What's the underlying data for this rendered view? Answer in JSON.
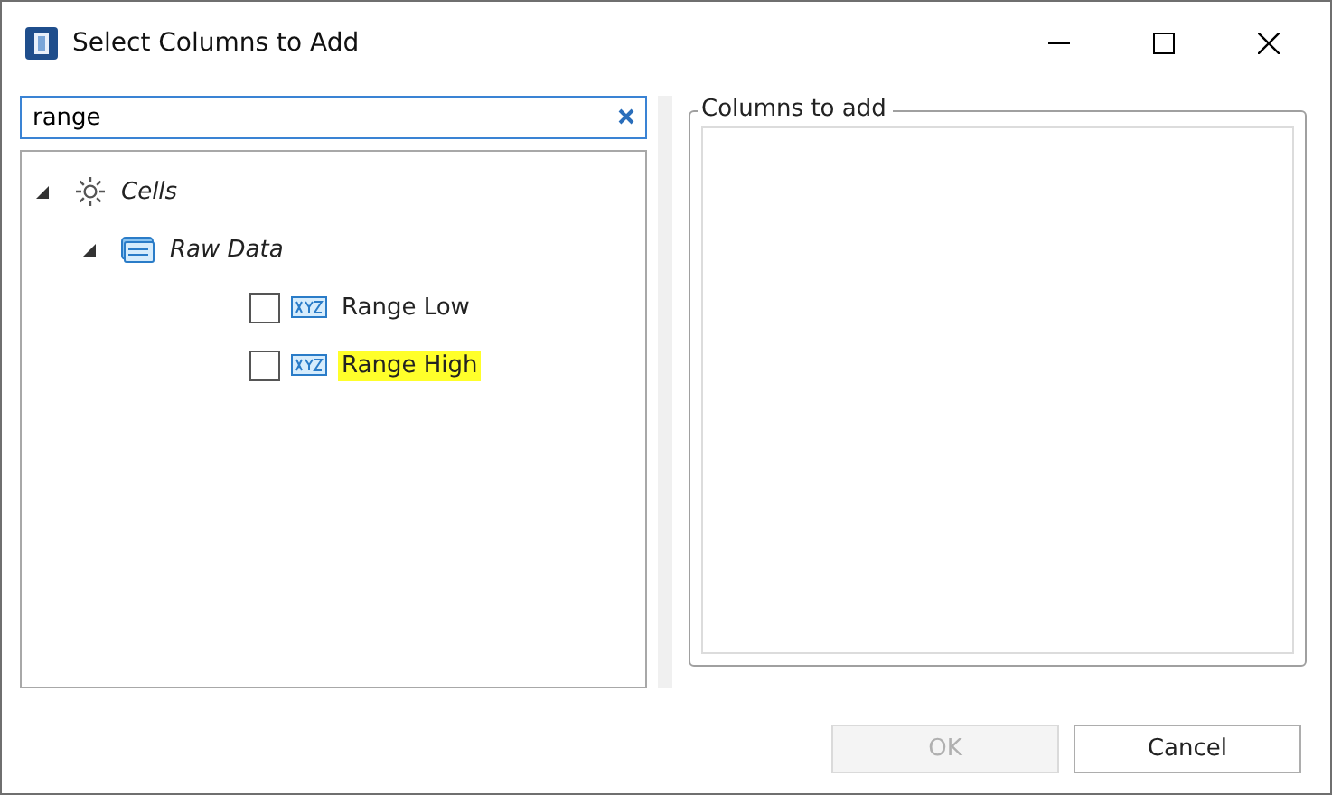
{
  "window": {
    "title": "Select Columns to Add"
  },
  "search": {
    "value": "range"
  },
  "tree": [
    {
      "kind": "category",
      "label": "Cells",
      "expanded": true,
      "children": [
        {
          "kind": "table",
          "label": "Raw Data",
          "expanded": true,
          "children": [
            {
              "kind": "column",
              "label": "Range Low",
              "checked": false,
              "highlighted": false
            },
            {
              "kind": "column",
              "label": "Range High",
              "checked": false,
              "highlighted": true
            }
          ]
        }
      ]
    }
  ],
  "columns_to_add": {
    "title": "Columns to add"
  },
  "buttons": [
    {
      "label": "OK",
      "disabled": true
    },
    {
      "label": "Cancel",
      "disabled": false
    }
  ]
}
